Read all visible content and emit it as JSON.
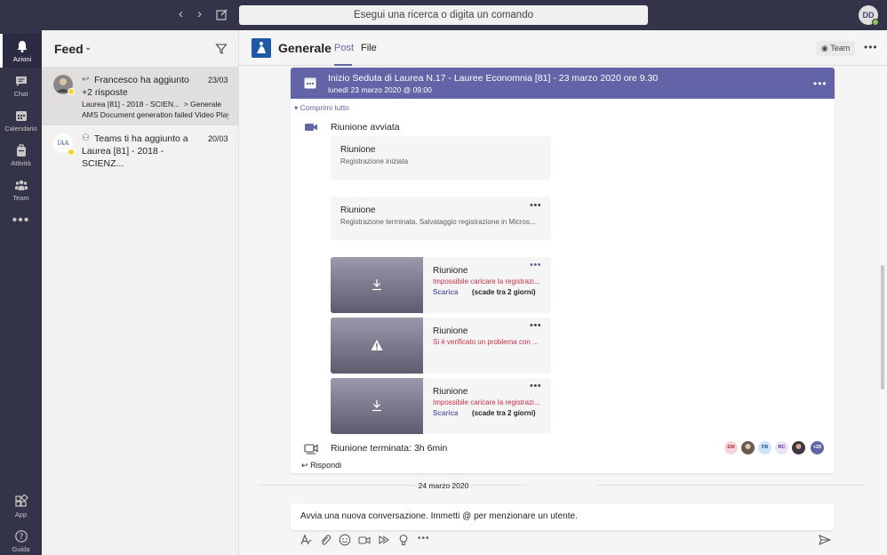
{
  "topbar": {
    "search_placeholder": "Esegui una ricerca o digita un comando",
    "user_initials": "DD"
  },
  "appbar": {
    "items": [
      {
        "label": "Azioni"
      },
      {
        "label": "Chat"
      },
      {
        "label": "Calendario"
      },
      {
        "label": "Attività"
      },
      {
        "label": "Team"
      },
      {
        "label": "App"
      },
      {
        "label": "Guida"
      }
    ]
  },
  "feed": {
    "title": "Feed",
    "items": [
      {
        "title": "Francesco ha aggiunto +2 risposte",
        "date": "23/03",
        "line1": "Laurea [81] - 2018 - SCIEN...",
        "line1_channel": "> Generale",
        "line2": "AMS Document generation failed Video Play"
      },
      {
        "title": "Teams ti ha aggiunto a Laurea [81] - 2018 - SCIENZ...",
        "date": "20/03"
      }
    ]
  },
  "channel": {
    "name": "Generale",
    "tabs": [
      "Post",
      "File"
    ],
    "team_button": "Team"
  },
  "post": {
    "title": "Inizio Seduta di Laurea N.17 - Lauree Economnia [81] - 23 marzo 2020 ore 9.30",
    "subtitle": "lunedì 23 marzo 2020 @ 09:00",
    "collapse_label": "Comprimi tutto",
    "meeting_started": "Riunione avviata",
    "cards": [
      {
        "title": "Riunione",
        "subtitle": "Registrazione iniziata"
      },
      {
        "title": "Riunione",
        "subtitle": "Registrazione terminata. Salvataggio registrazione in Micros..."
      }
    ],
    "recordings": [
      {
        "title": "Riunione",
        "error": "Impossibile caricare la registrazi...",
        "download": "Scarica",
        "expires": "(scade tra 2 giorni)"
      },
      {
        "title": "Riunione",
        "error": "Si è verificato un problema con ...",
        "download": "",
        "expires": ""
      },
      {
        "title": "Riunione",
        "error": "Impossibile caricare la registrazi...",
        "download": "Scarica",
        "expires": "(scade tra 2 giorni)"
      }
    ],
    "meeting_ended": "Riunione terminata: 3h 6min",
    "participants": [
      "EM",
      "",
      "FB",
      "RC",
      "",
      "+25"
    ],
    "reply_label": "Rispondi"
  },
  "date_separator": "24 marzo 2020",
  "compose": {
    "placeholder": "Avvia una nuova conversazione. Immetti @ per menzionare un utente."
  },
  "colors": {
    "accent": "#6264a7",
    "appbar": "#33344a",
    "error": "#c4314b"
  }
}
